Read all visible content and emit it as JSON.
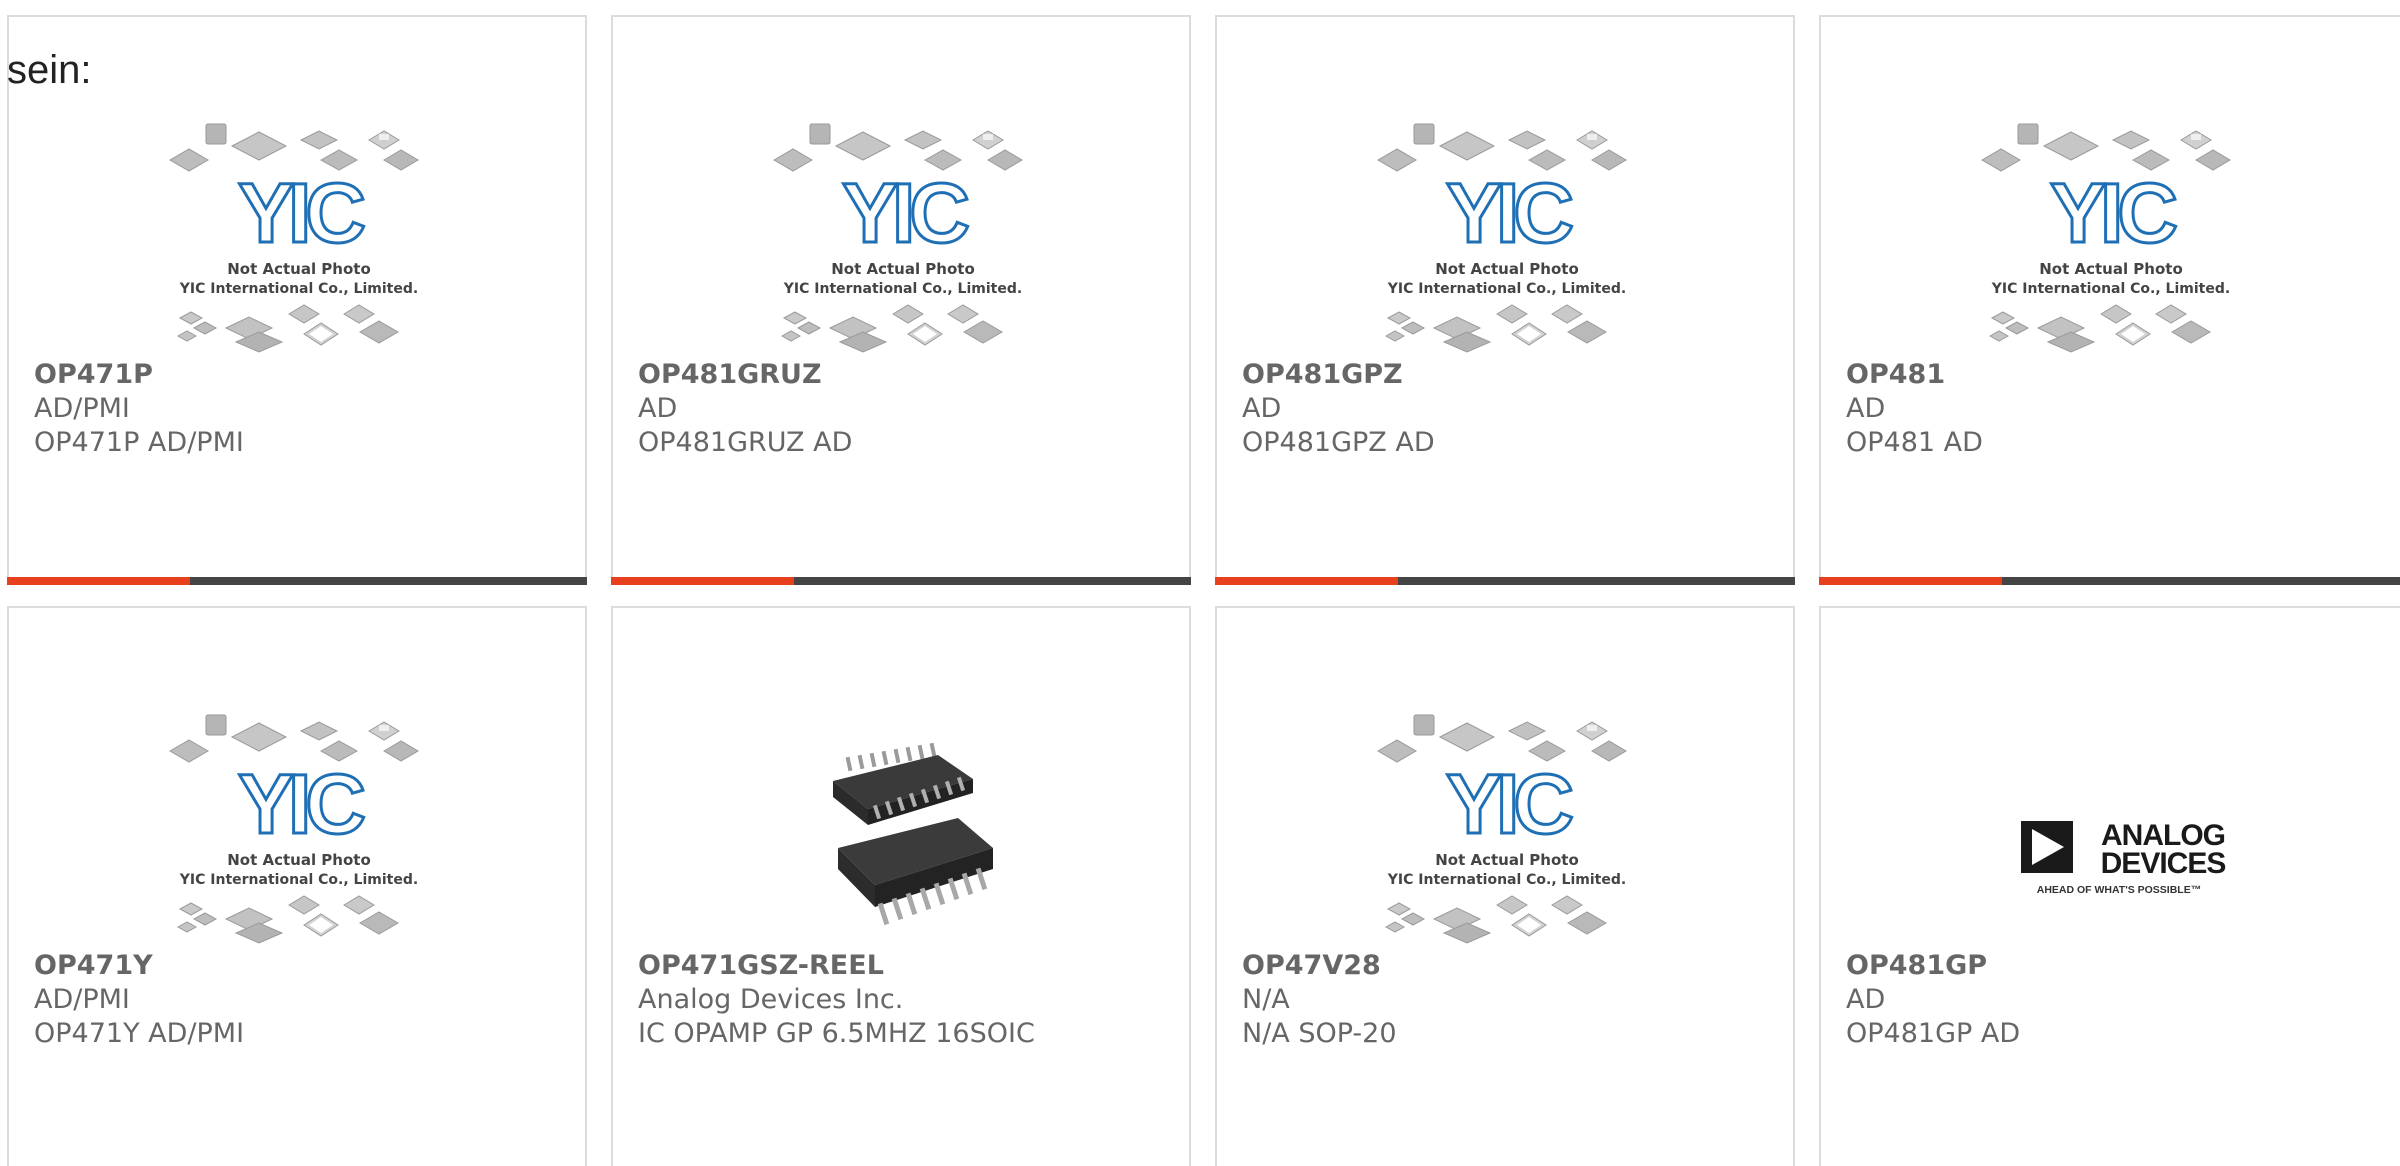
{
  "intro_text": "sein:",
  "placeholder": {
    "logo": "YIC",
    "caption_line1": "Not Actual Photo",
    "caption_line2": "YIC International Co., Limited."
  },
  "brand_logo": {
    "name": "ANALOG DEVICES",
    "line1": "ANALOG",
    "line2": "DEVICES",
    "tagline": "AHEAD OF WHAT'S POSSIBLE™"
  },
  "colors": {
    "accent": "#e8401c",
    "bar": "#444444",
    "text": "#666666",
    "border": "#dcdcdc",
    "yic_blue": "#1f6fb5"
  },
  "products": [
    {
      "part": "OP471P",
      "maker": "AD/PMI",
      "desc": "OP471P AD/PMI",
      "image": "placeholder"
    },
    {
      "part": "OP481GRUZ",
      "maker": "AD",
      "desc": "OP481GRUZ AD",
      "image": "placeholder"
    },
    {
      "part": "OP481GPZ",
      "maker": "AD",
      "desc": "OP481GPZ AD",
      "image": "placeholder"
    },
    {
      "part": "OP481",
      "maker": "AD",
      "desc": "OP481 AD",
      "image": "placeholder"
    },
    {
      "part": "OP471Y",
      "maker": "AD/PMI",
      "desc": "OP471Y AD/PMI",
      "image": "placeholder"
    },
    {
      "part": "OP471GSZ-REEL",
      "maker": "Analog Devices Inc.",
      "desc": "IC OPAMP GP 6.5MHZ 16SOIC",
      "image": "soic-chip"
    },
    {
      "part": "OP47V28",
      "maker": "N/A",
      "desc": "N/A SOP-20",
      "image": "placeholder"
    },
    {
      "part": "OP481GP",
      "maker": "AD",
      "desc": "OP481GP AD",
      "image": "brand-logo"
    }
  ]
}
